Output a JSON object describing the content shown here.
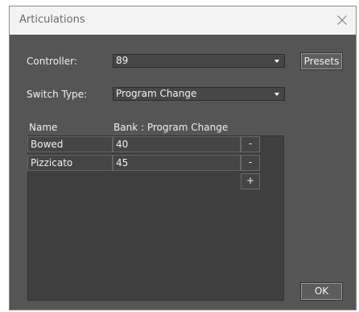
{
  "window": {
    "title": "Articulations",
    "close_label": "✕"
  },
  "controller": {
    "label": "Controller:",
    "value": "89"
  },
  "presets_button": "Presets",
  "switch_type": {
    "label": "Switch Type:",
    "value": "Program Change"
  },
  "table": {
    "headers": [
      "Name",
      "Bank : Program Change"
    ],
    "rows": [
      {
        "name": "Bowed",
        "value": "40",
        "remove_label": "-"
      },
      {
        "name": "Pizzicato",
        "value": "45",
        "remove_label": "-"
      }
    ],
    "add_label": "+"
  },
  "ok_button": "OK",
  "colors": {
    "dialog_bg": "#555555",
    "titlebar_bg": "#f3f3f3",
    "field_bg": "#474747",
    "grid_bg": "#3f3f3f"
  }
}
